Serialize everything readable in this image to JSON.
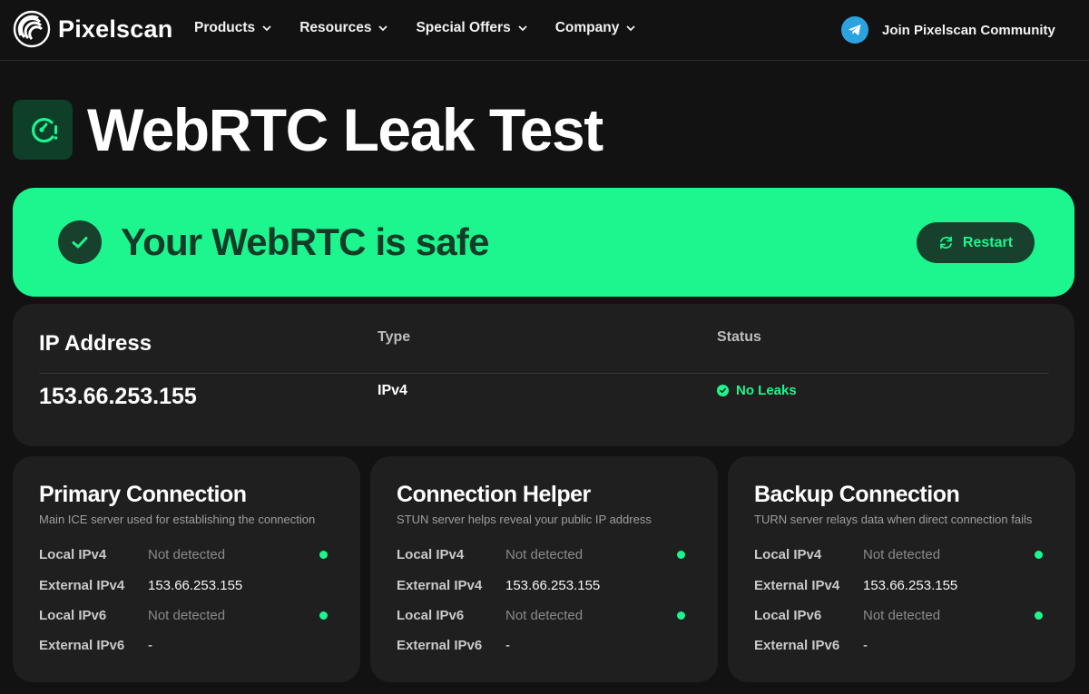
{
  "nav": {
    "brand": "Pixelscan",
    "menu": [
      {
        "label": "Products"
      },
      {
        "label": "Resources"
      },
      {
        "label": "Special Offers"
      },
      {
        "label": "Company"
      }
    ],
    "community_label": "Join Pixelscan Community"
  },
  "page": {
    "title": "WebRTC Leak Test"
  },
  "banner": {
    "message": "Your WebRTC is safe",
    "restart_label": "Restart",
    "accent_color": "#1df58e"
  },
  "ip_card": {
    "ip_header": "IP Address",
    "type_header": "Type",
    "status_header": "Status",
    "ip_value": "153.66.253.155",
    "type_value": "IPv4",
    "status_value": "No Leaks"
  },
  "connections": [
    {
      "title": "Primary Connection",
      "subtitle": "Main ICE server used for establishing the connection",
      "rows": [
        {
          "label": "Local IPv4",
          "value": "Not detected"
        },
        {
          "label": "External IPv4",
          "value": "153.66.253.155"
        },
        {
          "label": "Local IPv6",
          "value": "Not detected"
        },
        {
          "label": "External IPv6",
          "value": "-"
        }
      ]
    },
    {
      "title": "Connection Helper",
      "subtitle": "STUN server helps reveal your public IP address",
      "rows": [
        {
          "label": "Local IPv4",
          "value": "Not detected"
        },
        {
          "label": "External IPv4",
          "value": "153.66.253.155"
        },
        {
          "label": "Local IPv6",
          "value": "Not detected"
        },
        {
          "label": "External IPv6",
          "value": "-"
        }
      ]
    },
    {
      "title": "Backup Connection",
      "subtitle": "TURN server relays data when direct connection fails",
      "rows": [
        {
          "label": "Local IPv4",
          "value": "Not detected"
        },
        {
          "label": "External IPv4",
          "value": "153.66.253.155"
        },
        {
          "label": "Local IPv6",
          "value": "Not detected"
        },
        {
          "label": "External IPv6",
          "value": "-"
        }
      ]
    }
  ]
}
